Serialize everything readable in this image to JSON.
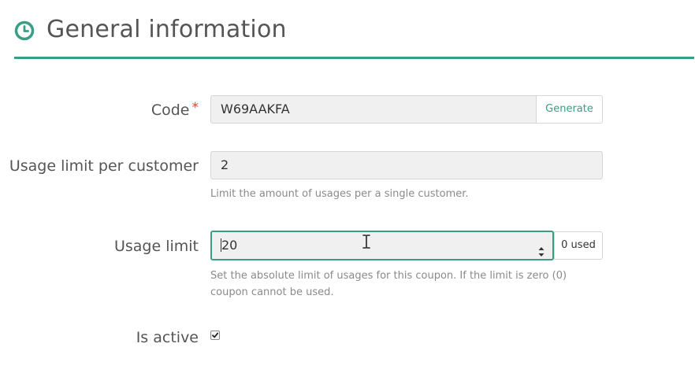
{
  "section": {
    "title": "General information",
    "icon": "clock-icon",
    "accent_color": "#3a9d84"
  },
  "form": {
    "code": {
      "label": "Code",
      "required_marker": "*",
      "value": "W69AAKFA",
      "generate_label": "Generate"
    },
    "usage_limit_per_customer": {
      "label": "Usage limit per customer",
      "value": "2",
      "help": "Limit the amount of usages per a single customer."
    },
    "usage_limit": {
      "label": "Usage limit",
      "value": "20",
      "used_label": "0 used",
      "help": "Set the absolute limit of usages for this coupon. If the limit is zero (0) coupon cannot be used."
    },
    "is_active": {
      "label": "Is active",
      "checked": true
    }
  }
}
